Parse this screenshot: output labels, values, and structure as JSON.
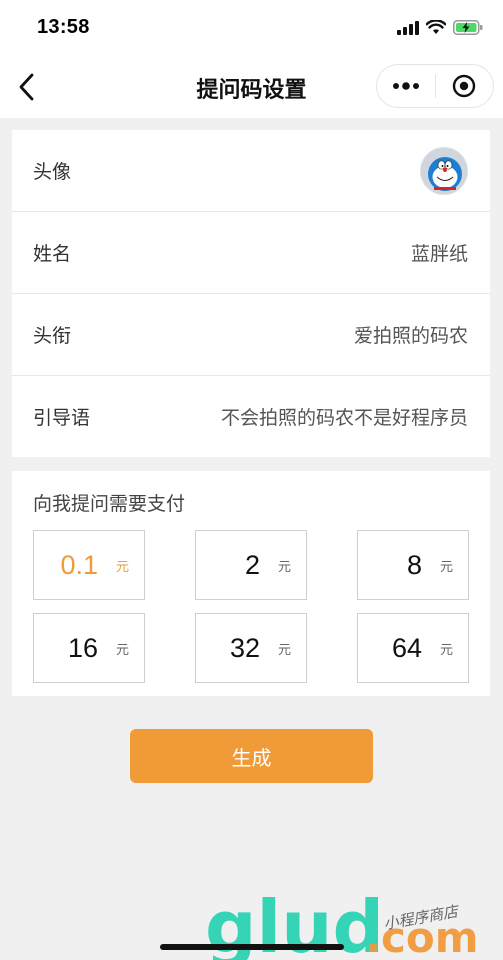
{
  "status": {
    "time": "13:58"
  },
  "nav": {
    "title": "提问码设置"
  },
  "profile": {
    "avatar_label": "头像",
    "name_label": "姓名",
    "name_value": "蓝胖纸",
    "title_label": "头衔",
    "title_value": "爱拍照的码农",
    "intro_label": "引导语",
    "intro_value": "不会拍照的码农不是好程序员"
  },
  "price": {
    "title": "向我提问需要支付",
    "unit": "元",
    "selected_index": 0,
    "options": [
      "0.1",
      "2",
      "8",
      "16",
      "32",
      "64"
    ]
  },
  "actions": {
    "generate_label": "生成"
  },
  "watermark": {
    "brand": "glud",
    "suffix": ".com",
    "tagline": "小程序商店"
  },
  "colors": {
    "accent": "#f19a38",
    "watermark_green": "#2cd3b4",
    "background": "#f0f0f0"
  },
  "icons": [
    "signal-icon",
    "wifi-icon",
    "battery-charging-icon",
    "back-icon",
    "more-icon",
    "target-icon"
  ]
}
